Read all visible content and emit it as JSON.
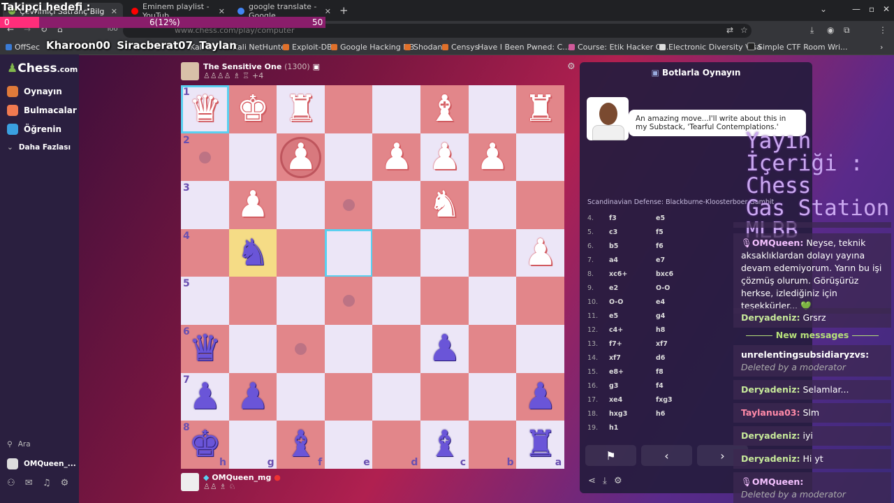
{
  "browser": {
    "tabs": [
      {
        "title": "Çevrimiçi Satranç Bilg",
        "color": "#81b64c"
      },
      {
        "title": "Eminem playlist - YouTub",
        "color": "#ff0000"
      },
      {
        "title": "google translate - Google",
        "color": "#4285f4"
      }
    ],
    "new_tab_label": "+",
    "url": "www.chess.com/play/computer",
    "toolbar_fragment": "Too",
    "bookmarks": [
      "OffSec",
      "Kali Li",
      "Kali NetHunter",
      "Exploit-DB",
      "Google Hacking DB",
      "Shodan",
      "Censys",
      "Have I Been Pwned: C...",
      "Course: Etik Hacker Ol...",
      "Electronic Diversity Visa",
      "Simple CTF Room Wri..."
    ]
  },
  "overlay": {
    "goal_title": "Takipçi hedefi :",
    "goal_current": "6(12%)",
    "goal_min": "0",
    "goal_max": "50",
    "goal_percent": 12,
    "names": "Kharoon00 Siracberat07 Taylan",
    "stream_topics": [
      "Yayın İçeriği :",
      "Chess",
      "Gas Station",
      "MLBB"
    ]
  },
  "nav": {
    "logo_text": "Chess",
    "logo_suffix": ".com",
    "items": [
      {
        "label": "Oynayın",
        "color": "#e07a3a"
      },
      {
        "label": "Bulmacalar",
        "color": "#f07a50"
      },
      {
        "label": "Öğrenin",
        "color": "#3aa0e0"
      }
    ],
    "more_label": "Daha Fazlası",
    "search_label": "Ara",
    "user_label": "OMQueen_..."
  },
  "opponent": {
    "name": "The Sensitive One",
    "rating": "(1300)",
    "captured": "♙♙♙♙ ♗ ♖",
    "advantage": "+4"
  },
  "player": {
    "name": "OMQueen_mg",
    "captured": "♙♙ ♗ ♘"
  },
  "board": {
    "ranks": [
      "1",
      "2",
      "3",
      "4",
      "5",
      "6",
      "7",
      "8"
    ],
    "files": [
      "h",
      "g",
      "f",
      "e",
      "d",
      "c",
      "b",
      "a"
    ],
    "pieces": [
      {
        "sq": "h1",
        "glyph": "♛",
        "side": "w"
      },
      {
        "sq": "g1",
        "glyph": "♚",
        "side": "w"
      },
      {
        "sq": "f1",
        "glyph": "♜",
        "side": "w"
      },
      {
        "sq": "c1",
        "glyph": "♝",
        "side": "w"
      },
      {
        "sq": "a1",
        "glyph": "♜",
        "side": "w"
      },
      {
        "sq": "f2",
        "glyph": "♟",
        "side": "w"
      },
      {
        "sq": "d2",
        "glyph": "♟",
        "side": "w"
      },
      {
        "sq": "c2",
        "glyph": "♟",
        "side": "w"
      },
      {
        "sq": "b2",
        "glyph": "♟",
        "side": "w"
      },
      {
        "sq": "g3",
        "glyph": "♟",
        "side": "w"
      },
      {
        "sq": "c3",
        "glyph": "♞",
        "side": "w"
      },
      {
        "sq": "a4",
        "glyph": "♟",
        "side": "w"
      },
      {
        "sq": "g4",
        "glyph": "♞",
        "side": "b"
      },
      {
        "sq": "h6",
        "glyph": "♛",
        "side": "b"
      },
      {
        "sq": "c6",
        "glyph": "♟",
        "side": "b"
      },
      {
        "sq": "h7",
        "glyph": "♟",
        "side": "b"
      },
      {
        "sq": "g7",
        "glyph": "♟",
        "side": "b"
      },
      {
        "sq": "a7",
        "glyph": "♟",
        "side": "b"
      },
      {
        "sq": "h8",
        "glyph": "♚",
        "side": "b"
      },
      {
        "sq": "f8",
        "glyph": "♝",
        "side": "b"
      },
      {
        "sq": "c8",
        "glyph": "♝",
        "side": "b"
      },
      {
        "sq": "a8",
        "glyph": "♜",
        "side": "b"
      }
    ],
    "highlight": [
      "g4"
    ],
    "selected": [
      "h1",
      "e4"
    ],
    "dots": [
      "h2",
      "e3",
      "e5",
      "f6"
    ],
    "capture_ring": [
      "f2"
    ]
  },
  "panel": {
    "title": "Botlarla Oynayın",
    "speech": "An amazing move...I'll write about this in my Substack, 'Tearful Contemplations.'",
    "opening": "Scandinavian Defense: Blackburne-Kloosterboer Gambit",
    "moves": [
      {
        "n": "4.",
        "w": "f3",
        "b": "e5"
      },
      {
        "n": "5.",
        "w": "c3",
        "b": "f5"
      },
      {
        "n": "6.",
        "w": "b5",
        "b": "f6"
      },
      {
        "n": "7.",
        "w": "a4",
        "b": "e7"
      },
      {
        "n": "8.",
        "w": "xc6+",
        "b": "bxc6"
      },
      {
        "n": "9.",
        "w": "e2",
        "b": "O-O"
      },
      {
        "n": "10.",
        "w": "O-O",
        "b": "e4"
      },
      {
        "n": "11.",
        "w": "e5",
        "b": "g4"
      },
      {
        "n": "12.",
        "w": "c4+",
        "b": "h8"
      },
      {
        "n": "13.",
        "w": "f7+",
        "b": "xf7"
      },
      {
        "n": "14.",
        "w": "xf7",
        "b": "d6"
      },
      {
        "n": "15.",
        "w": "e8+",
        "b": "f8"
      },
      {
        "n": "16.",
        "w": "g3",
        "b": "f4"
      },
      {
        "n": "17.",
        "w": "xe4",
        "b": "fxg3"
      },
      {
        "n": "18.",
        "w": "hxg3",
        "b": "h6"
      },
      {
        "n": "19.",
        "w": "h1",
        "b": ""
      }
    ]
  },
  "chat": {
    "new_messages_label": "New messages",
    "messages": [
      {
        "user": "OMQueen:",
        "text": "Neyse, teknik aksaklıklardan dolayı yayına devam edemiyorum. Yarın bu işi çözmüş olurum. Görüşürüz herkse, izlediğiniz için teşekkürler... 💚",
        "cls": "u-p"
      },
      {
        "user": "Deryadeniz:",
        "text": "Grsrz",
        "cls": "u-g"
      },
      {
        "user": "unrelentingsubsidiaryzvs:",
        "text": "Deleted by a moderator",
        "cls": "u-w"
      },
      {
        "user": "Deryadeniz:",
        "text": "Selamlar...",
        "cls": "u-g"
      },
      {
        "user": "Taylanua03:",
        "text": "Slm",
        "cls": "u-r"
      },
      {
        "user": "Deryadeniz:",
        "text": "iyi",
        "cls": "u-g"
      },
      {
        "user": "Deryadeniz:",
        "text": "Hi yt",
        "cls": "u-g"
      },
      {
        "user": "OMQueen:",
        "text": "Deleted by a moderator",
        "cls": "u-p"
      }
    ]
  }
}
